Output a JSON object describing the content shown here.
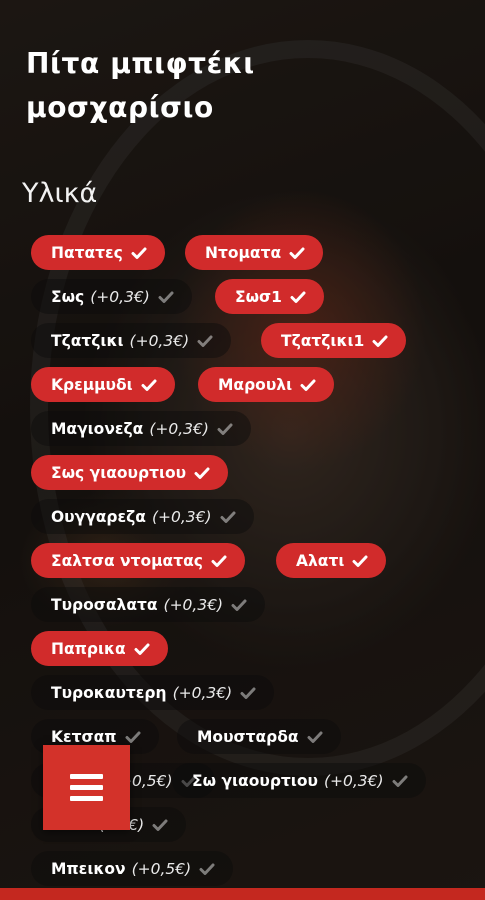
{
  "page": {
    "title": "Πίτα μπιφτέκι μοσχαρίσιο",
    "section_title": "Υλικά",
    "accent_color": "#d12b2b"
  },
  "ingredients": [
    {
      "label": "Πατατες",
      "price": "",
      "selected": true
    },
    {
      "label": "Ντοματα",
      "price": "",
      "selected": true
    },
    {
      "label": "Σως",
      "price": "(+0,3€)",
      "selected": false
    },
    {
      "label": "Σωσ1",
      "price": "",
      "selected": true
    },
    {
      "label": "Τζατζικι",
      "price": "(+0,3€)",
      "selected": false
    },
    {
      "label": "Τζατζικι1",
      "price": "",
      "selected": true
    },
    {
      "label": "Κρεμμυδι",
      "price": "",
      "selected": true
    },
    {
      "label": "Μαρουλι",
      "price": "",
      "selected": true
    },
    {
      "label": "Μαγιονεζα",
      "price": "(+0,3€)",
      "selected": false
    },
    {
      "label": "Σως γιαουρτιου",
      "price": "",
      "selected": true
    },
    {
      "label": "Ουγγαρεζα",
      "price": "(+0,3€)",
      "selected": false
    },
    {
      "label": "Σαλτσα ντοματας",
      "price": "",
      "selected": true
    },
    {
      "label": "Αλατι",
      "price": "",
      "selected": true
    },
    {
      "label": "Τυροσαλατα",
      "price": "(+0,3€)",
      "selected": false
    },
    {
      "label": "Παπρικα",
      "price": "",
      "selected": true
    },
    {
      "label": "Τυροκαυτερη",
      "price": "(+0,3€)",
      "selected": false
    },
    {
      "label": "Κετσαπ",
      "price": "",
      "selected": false
    },
    {
      "label": "Μουσταρδα",
      "price": "",
      "selected": false
    },
    {
      "label": "Gouda",
      "price": "(+0,5€)",
      "selected": false
    },
    {
      "label": "Σω γιαουρτιου",
      "price": "(+0,3€)",
      "selected": false
    },
    {
      "label": "Φετα",
      "price": "(+1€)",
      "selected": false
    },
    {
      "label": "Μπεικον",
      "price": "(+0,5€)",
      "selected": false
    }
  ],
  "menu_button": {
    "icon": "hamburger-menu-icon"
  }
}
